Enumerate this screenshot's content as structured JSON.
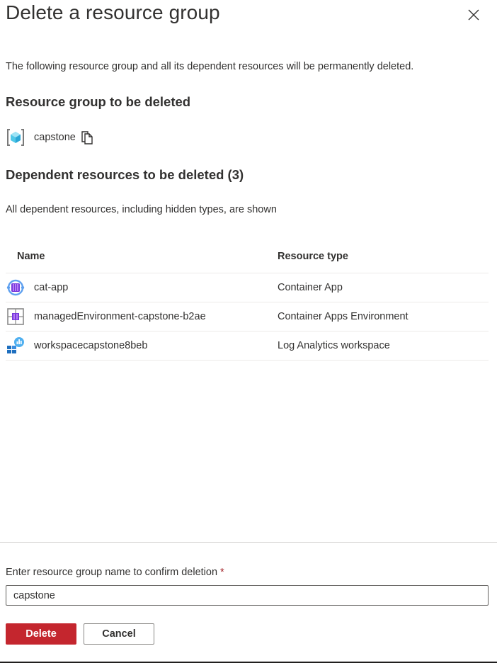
{
  "dialog": {
    "title": "Delete a resource group",
    "description": "The following resource group and all its dependent resources will be permanently deleted."
  },
  "resource_group": {
    "heading": "Resource group to be deleted",
    "name": "capstone",
    "icon": "resource-group-icon"
  },
  "dependents": {
    "heading": "Dependent resources to be deleted (3)",
    "note": "All dependent resources, including hidden types, are shown",
    "columns": {
      "name": "Name",
      "type": "Resource type"
    },
    "rows": [
      {
        "name": "cat-app",
        "type": "Container App",
        "icon": "container-app-icon"
      },
      {
        "name": "managedEnvironment-capstone-b2ae",
        "type": "Container Apps Environment",
        "icon": "container-apps-environment-icon"
      },
      {
        "name": "workspacecapstone8beb",
        "type": "Log Analytics workspace",
        "icon": "log-analytics-workspace-icon"
      }
    ]
  },
  "confirm": {
    "label": "Enter resource group name to confirm deletion",
    "required_mark": "*",
    "value": "capstone"
  },
  "buttons": {
    "delete": "Delete",
    "cancel": "Cancel"
  },
  "colors": {
    "danger": "#c4262e",
    "text": "#323130",
    "required": "#a4262c"
  }
}
